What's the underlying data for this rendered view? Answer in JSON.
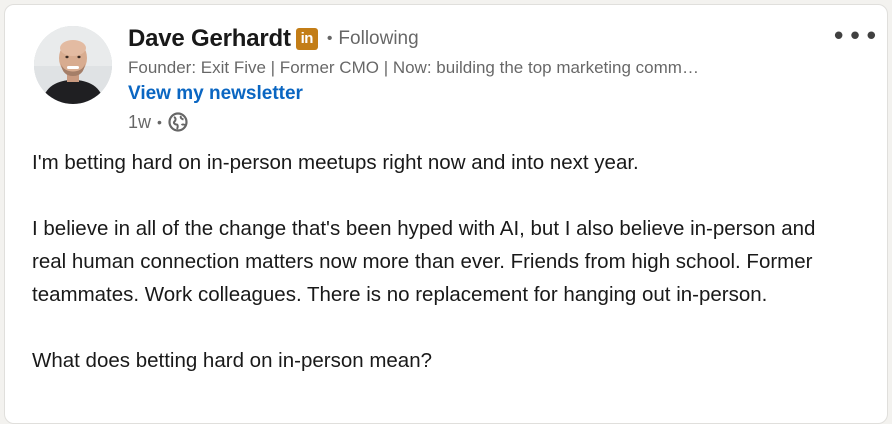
{
  "post": {
    "author": {
      "name": "Dave Gerhardt",
      "badge": "in",
      "follow_status": "Following",
      "headline": "Founder: Exit Five | Former CMO | Now: building the top marketing comm…",
      "newsletter_link": "View my newsletter",
      "avatar_icon": "person-avatar"
    },
    "timestamp": "1w",
    "visibility_icon": "globe-icon",
    "more_menu_icon": "ellipsis-icon",
    "paragraphs": [
      "I'm betting hard on in-person meetups right now and into next year.",
      "I believe in all of the change that's been hyped with AI, but I also believe in-person and real human connection matters now more than ever. Friends from high school. Former teammates. Work colleagues. There is no replacement for hanging out in-person.",
      "What does betting hard on in-person mean?"
    ]
  },
  "colors": {
    "link_blue": "#0a66c2",
    "premium_gold": "#c37d16",
    "card_bg": "#ffffff",
    "page_bg": "#f3f2ef"
  }
}
